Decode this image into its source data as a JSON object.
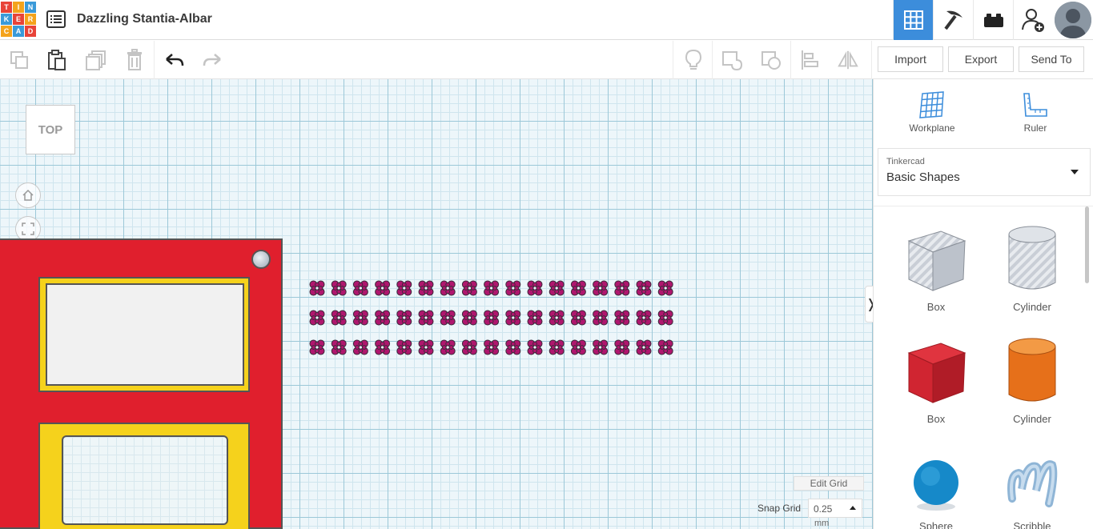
{
  "app": {
    "logo_letters": [
      "T",
      "I",
      "N",
      "K",
      "E",
      "R",
      "C",
      "A",
      "D"
    ],
    "logo_colors": [
      "#e84338",
      "#f4a31c",
      "#3a9ad9",
      "#3a9ad9",
      "#e84338",
      "#f4a31c",
      "#f4a31c",
      "#3a9ad9",
      "#e84338"
    ],
    "design_title": "Dazzling Stantia-Albar",
    "accent_color": "#3c8ddb"
  },
  "top_nav": [
    {
      "name": "3d-design-view",
      "icon": "grid-icon",
      "active": true
    },
    {
      "name": "codeblocks",
      "icon": "pickaxe-icon",
      "active": false
    },
    {
      "name": "lego-bricks",
      "icon": "brick-icon",
      "active": false
    },
    {
      "name": "invite-user",
      "icon": "add-user-icon",
      "active": false
    }
  ],
  "toolbar": {
    "import_label": "Import",
    "export_label": "Export",
    "send_to_label": "Send To"
  },
  "view": {
    "viewcube_label": "TOP",
    "edit_grid_label": "Edit Grid",
    "snap_grid_label": "Snap Grid",
    "snap_grid_value": "0.25",
    "snap_grid_unit": "mm"
  },
  "right_panel": {
    "workplane_label": "Workplane",
    "ruler_label": "Ruler",
    "library_category": "Tinkercad",
    "library_name": "Basic Shapes",
    "shapes": [
      {
        "label": "Box",
        "icon": "box-hole-icon"
      },
      {
        "label": "Cylinder",
        "icon": "cylinder-hole-icon"
      },
      {
        "label": "Box",
        "icon": "box-icon"
      },
      {
        "label": "Cylinder",
        "icon": "cylinder-icon"
      },
      {
        "label": "Sphere",
        "icon": "sphere-icon"
      },
      {
        "label": "Scribble",
        "icon": "scribble-icon"
      }
    ]
  },
  "scene": {
    "panel_color": "#e01f2d",
    "frame_color": "#f5d21c",
    "pattern_color": "#b0166e",
    "clover_columns": 17,
    "clover_rows": 3
  }
}
